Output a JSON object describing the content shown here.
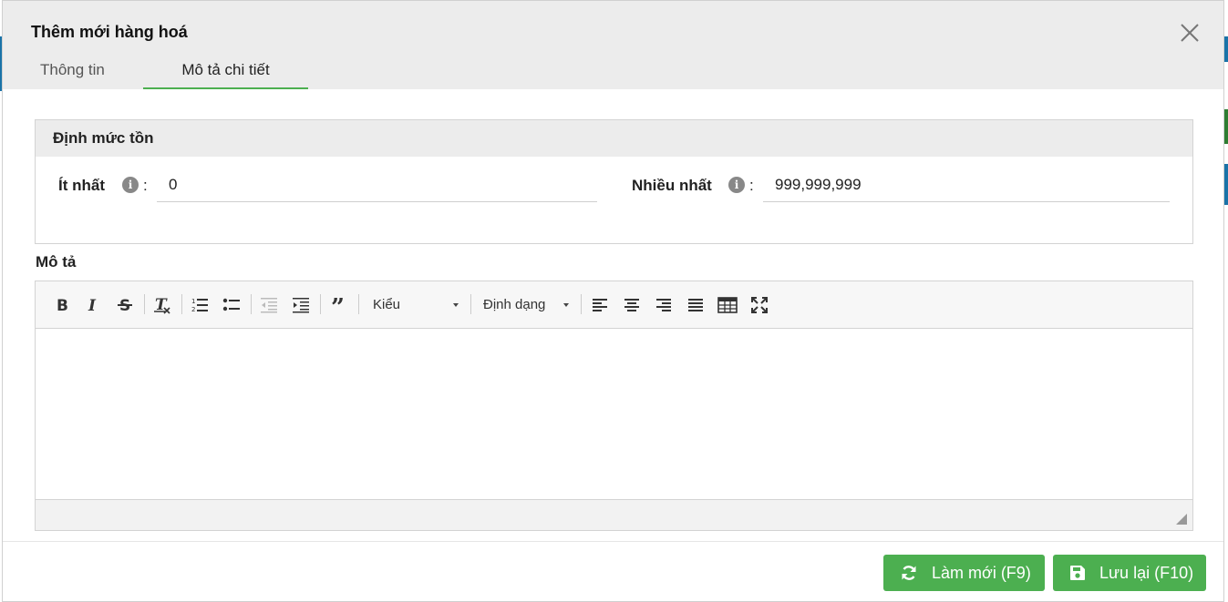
{
  "modal": {
    "title": "Thêm mới hàng hoá",
    "tabs": [
      {
        "label": "Thông tin",
        "active": false
      },
      {
        "label": "Mô tả chi tiết",
        "active": true
      }
    ]
  },
  "inventory": {
    "section_title": "Định mức tồn",
    "min_label": "Ít nhất",
    "min_value": "0",
    "max_label": "Nhiều nhất",
    "max_value": "999,999,999",
    "colon": ":"
  },
  "description": {
    "label": "Mô tả",
    "toolbar": {
      "style_dropdown": "Kiểu",
      "format_dropdown": "Định dạng",
      "icons": [
        "bold-icon",
        "italic-icon",
        "strikethrough-icon",
        "remove-format-icon",
        "numbered-list-icon",
        "bulleted-list-icon",
        "outdent-icon",
        "indent-icon",
        "blockquote-icon",
        "align-left-icon",
        "align-center-icon",
        "align-right-icon",
        "align-justify-icon",
        "table-icon",
        "maximize-icon"
      ]
    },
    "content": ""
  },
  "footer": {
    "refresh_label": "Làm mới (F9)",
    "save_label": "Lưu lại (F10)"
  },
  "colors": {
    "accent_green": "#4caf50",
    "header_bg": "#ececec"
  }
}
